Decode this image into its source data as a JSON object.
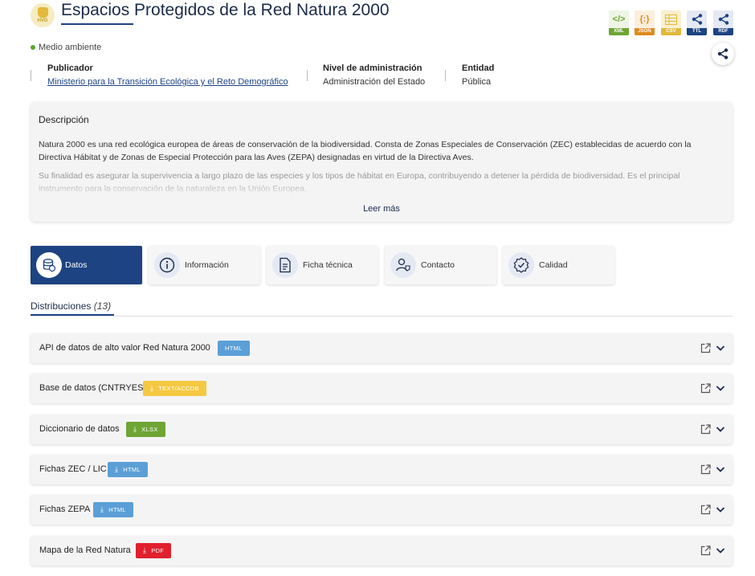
{
  "header": {
    "badge_label": "HVD",
    "title": "Espacios Protegidos de la Red Natura 2000",
    "topic": "Medio ambiente",
    "formats": [
      {
        "label": "XML",
        "icon": "code-icon",
        "glyph": "</>",
        "color": "#6ea535",
        "bg": "#eef5e4"
      },
      {
        "label": "JSON",
        "icon": "json-icon",
        "glyph": "{:}",
        "color": "#e08a1c",
        "bg": "#fbefdc"
      },
      {
        "label": "CSV",
        "icon": "csv-icon",
        "glyph": "",
        "color": "#e2b93b",
        "bg": "#faf0cf"
      },
      {
        "label": "TTL",
        "icon": "graph-icon",
        "glyph": "",
        "color": "#1d4382",
        "bg": "#e4e9f4"
      },
      {
        "label": "RDF",
        "icon": "graph-icon",
        "glyph": "",
        "color": "#1d4382",
        "bg": "#e4e9f4"
      }
    ]
  },
  "meta": {
    "publisher_label": "Publicador",
    "publisher_value": "Ministerio para la Transición Ecológica y el Reto Demográfico",
    "admin_label": "Nivel de administración",
    "admin_value": "Administración del Estado",
    "entity_label": "Entidad",
    "entity_value": "Pública"
  },
  "description": {
    "title": "Descripción",
    "p1": "Natura 2000 es una red ecológica europea de áreas de conservación de la biodiversidad. Consta de Zonas Especiales de Conservación (ZEC) establecidas de acuerdo con la Directiva Hábitat y de Zonas de Especial Protección para las Aves (ZEPA) designadas en virtud de la Directiva Aves.",
    "p2": "Su finalidad es asegurar la supervivencia a largo plazo de las especies y los tipos de hábitat en Europa, contribuyendo a detener la pérdida de biodiversidad. Es el principal instrumento para la conservación de la naturaleza en la Unión Europea.",
    "read_more": "Leer más"
  },
  "tabs": [
    {
      "label": "Datos",
      "icon": "database-icon",
      "active": true
    },
    {
      "label": "Información",
      "icon": "info-icon",
      "active": false
    },
    {
      "label": "Ficha técnica",
      "icon": "document-icon",
      "active": false
    },
    {
      "label": "Contacto",
      "icon": "contact-icon",
      "active": false
    },
    {
      "label": "Calidad",
      "icon": "quality-seal-icon",
      "active": false
    }
  ],
  "distributions": {
    "heading": "Distribuciones",
    "count": "(13)",
    "items": [
      {
        "name": "API de datos de alto valor Red Natura 2000",
        "format": "HTML",
        "download": false,
        "color": "#5b9fd6"
      },
      {
        "name": "Base de datos (CNTRYES)",
        "format": "TEXT/ACCDB",
        "download": true,
        "color": "#f5c842"
      },
      {
        "name": "Diccionario de datos",
        "format": "XLSX",
        "download": true,
        "color": "#6ea535"
      },
      {
        "name": "Fichas ZEC / LIC",
        "format": "HTML",
        "download": true,
        "color": "#5b9fd6"
      },
      {
        "name": "Fichas ZEPA",
        "format": "HTML",
        "download": true,
        "color": "#5b9fd6"
      },
      {
        "name": "Mapa de la Red Natura",
        "format": "PDF",
        "download": true,
        "color": "#e0202e"
      }
    ]
  }
}
